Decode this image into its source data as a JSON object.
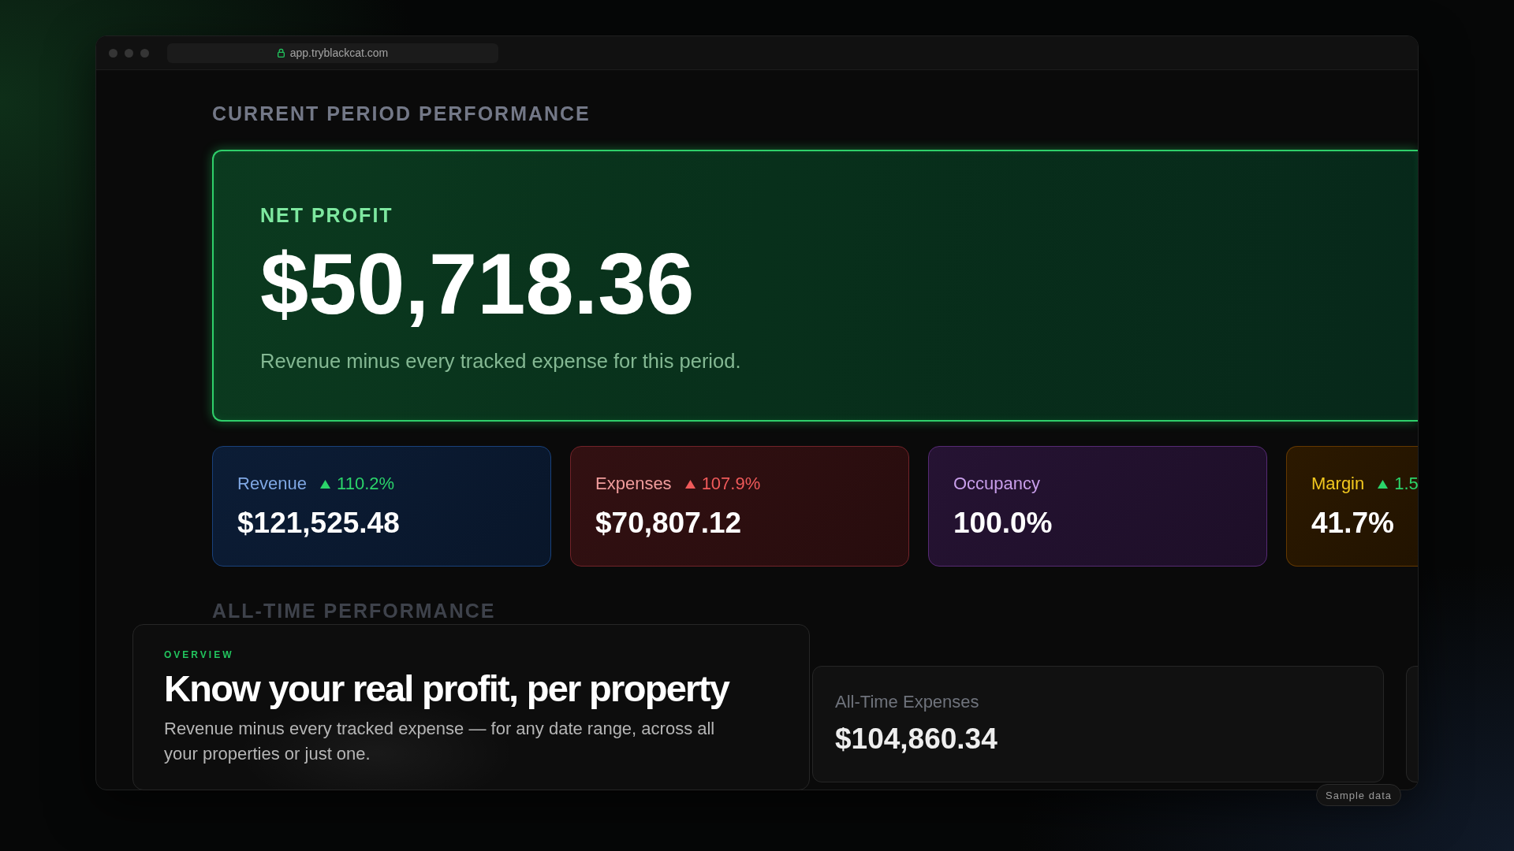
{
  "browser": {
    "url": "app.tryblackcat.com",
    "secure": true
  },
  "current_period": {
    "heading": "CURRENT PERIOD PERFORMANCE",
    "net_profit": {
      "label": "NET PROFIT",
      "value": "$50,718.36",
      "description": "Revenue minus every tracked expense for this period."
    },
    "metrics": [
      {
        "label": "Revenue",
        "color": "#7fa7e3",
        "change": {
          "rising": true,
          "favorable": true,
          "text": "110.2%"
        },
        "value": "$121,525.48"
      },
      {
        "label": "Expenses",
        "color": "#f09c9c",
        "change": {
          "rising": true,
          "favorable": false,
          "text": "107.9%"
        },
        "value": "$70,807.12"
      },
      {
        "label": "Occupancy",
        "color": "#c89eea",
        "value": "100.0%"
      },
      {
        "label": "Margin",
        "color": "#f2c81e",
        "change": {
          "rising": true,
          "favorable": true,
          "text": "1.5"
        },
        "value": "41.7%"
      }
    ]
  },
  "all_time": {
    "heading": "ALL-TIME PERFORMANCE",
    "cards": [
      {
        "label": "All-Time Expenses",
        "value": "$104,860.34"
      }
    ]
  },
  "overview": {
    "eyebrow": "OVERVIEW",
    "title": "Know your real profit, per property",
    "text": "Revenue minus every tracked expense — for any date range, across all your properties or just one."
  },
  "badge": "Sample data"
}
